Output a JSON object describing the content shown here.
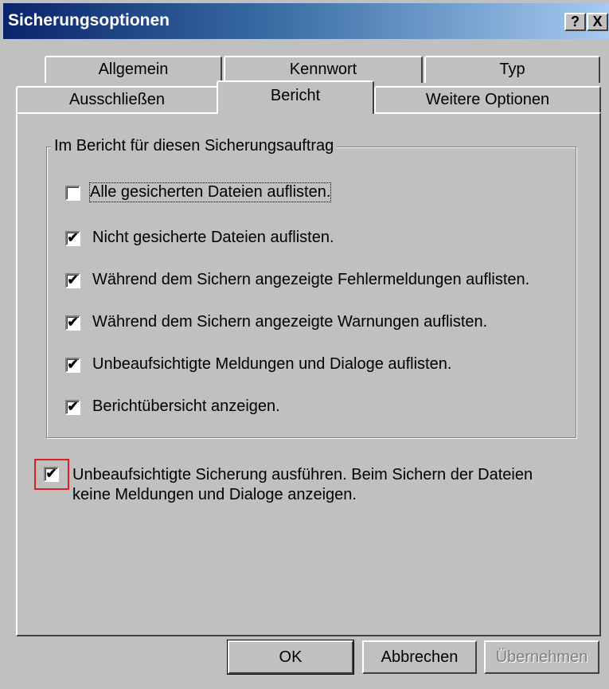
{
  "window": {
    "title": "Sicherungsoptionen",
    "help_label": "?",
    "close_label": "X"
  },
  "tabs": {
    "back_row": [
      "Allgemein",
      "Kennwort",
      "Typ"
    ],
    "front_row": [
      "Ausschließen",
      "Bericht",
      "Weitere Optionen"
    ],
    "active": "Bericht"
  },
  "group": {
    "legend": "Im Bericht für diesen Sicherungsauftrag"
  },
  "options": [
    {
      "label": "Alle gesicherten Dateien auflisten.",
      "checked": false,
      "mark": ""
    },
    {
      "label": "Nicht gesicherte Dateien auflisten.",
      "checked": true,
      "mark": "✔"
    },
    {
      "label": "Während dem Sichern angezeigte Fehlermeldungen auflisten.",
      "checked": true,
      "mark": "✔"
    },
    {
      "label": "Während dem Sichern angezeigte Warnungen auflisten.",
      "checked": true,
      "mark": "✔"
    },
    {
      "label": "Unbeaufsichtigte Meldungen und Dialoge auflisten.",
      "checked": true,
      "mark": "✔"
    },
    {
      "label": "Berichtübersicht anzeigen.",
      "checked": true,
      "mark": "✔"
    }
  ],
  "unattended": {
    "line1": "Unbeaufsichtigte Sicherung ausführen. Beim Sichern der Dateien",
    "line2": "keine Meldungen und Dialoge anzeigen.",
    "checked": true,
    "mark": "✔"
  },
  "buttons": {
    "ok": "OK",
    "cancel": "Abbrechen",
    "apply": "Übernehmen"
  },
  "colors": {
    "titlebar_start": "#0a246a",
    "titlebar_end": "#a6caf0",
    "face": "#c0c0c0",
    "highlight_box": "#e02020"
  }
}
